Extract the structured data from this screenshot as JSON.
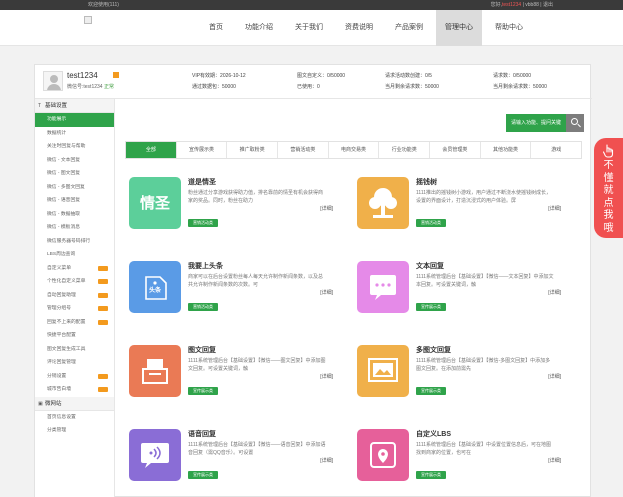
{
  "topbar": {
    "welcome": "欢迎使用(111)",
    "account_prefix": "您好,",
    "account_name": "test1234",
    "account_sep": "  |  vbb88  |  ",
    "logout": "退出"
  },
  "nav": {
    "items": [
      {
        "label": "首页"
      },
      {
        "label": "功能介绍"
      },
      {
        "label": "关于我们"
      },
      {
        "label": "资费说明"
      },
      {
        "label": "产品案例"
      },
      {
        "label": "管理中心"
      },
      {
        "label": "帮助中心"
      }
    ],
    "active": "管理中心"
  },
  "user": {
    "name": "test1234",
    "sub_prefix": "微信号:test1234 ",
    "sub_status": "正常",
    "stats": [
      {
        "text": "VIP有效期：2026-10-12"
      },
      {
        "text": "通过数据包：50000"
      },
      {
        "text": "图文自定义：0/50000"
      },
      {
        "text": "已使用：0"
      },
      {
        "text": "请求活动数创建：0/5"
      },
      {
        "text": "当月剩余请求数：50000"
      },
      {
        "text": "请求数：0/50000"
      },
      {
        "text": "当月剩余请求数：50000"
      }
    ]
  },
  "sidebar": {
    "section1": "基础设置",
    "items": [
      {
        "label": "功能展示",
        "active": true,
        "tag": false
      },
      {
        "label": "数据统计",
        "active": false,
        "tag": false
      },
      {
        "label": "关注时回复与帮助",
        "active": false,
        "tag": false
      },
      {
        "label": "微信 - 文本回复",
        "active": false,
        "tag": false
      },
      {
        "label": "微信 - 图文回复",
        "active": false,
        "tag": false
      },
      {
        "label": "微信 - 多图文回复",
        "active": false,
        "tag": false
      },
      {
        "label": "微信 - 语音回复",
        "active": false,
        "tag": false
      },
      {
        "label": "微信 - 数据抽取",
        "active": false,
        "tag": false
      },
      {
        "label": "微信 - 模板消息",
        "active": false,
        "tag": false
      },
      {
        "label": "微信服务器号码排行",
        "active": false,
        "tag": false
      },
      {
        "label": "LBS周边查询",
        "active": false,
        "tag": false
      },
      {
        "label": "自定义菜单",
        "active": false,
        "tag": true
      },
      {
        "label": "个性化自定义菜单",
        "active": false,
        "tag": true
      },
      {
        "label": "自动回复助理",
        "active": false,
        "tag": true
      },
      {
        "label": "管理分组号",
        "active": false,
        "tag": true
      },
      {
        "label": "回复不上来的配置",
        "active": false,
        "tag": true
      },
      {
        "label": "快捷平台配置",
        "active": false,
        "tag": false
      },
      {
        "label": "图文回复生成工具",
        "active": false,
        "tag": false
      },
      {
        "label": "评论回复管理",
        "active": false,
        "tag": false
      },
      {
        "label": "分销设置",
        "active": false,
        "tag": true
      },
      {
        "label": "城市告白墙",
        "active": false,
        "tag": true
      }
    ],
    "section2": "微网站",
    "items2": [
      {
        "label": "首页信息设置"
      },
      {
        "label": "分类管理"
      }
    ]
  },
  "toolbar": {
    "add_label": "请输入功能、提问关键",
    "search_icon": "search-icon"
  },
  "tabs": [
    {
      "label": "全部",
      "active": true
    },
    {
      "label": "宣传展示类",
      "active": false
    },
    {
      "label": "推广取粉类",
      "active": false
    },
    {
      "label": "营销活动类",
      "active": false
    },
    {
      "label": "电商交易类",
      "active": false
    },
    {
      "label": "行业功能类",
      "active": false
    },
    {
      "label": "会员管理类",
      "active": false
    },
    {
      "label": "其他功能类",
      "active": false
    },
    {
      "label": "游戏",
      "active": false
    }
  ],
  "cards": [
    {
      "title": "道是情圣",
      "desc": "粉丝通过分享游戏获得助力值，排名靠前的情圣有机会获得商家的奖品。同时，粉丝在助力",
      "more": "[详细]",
      "tag": "营销活动类",
      "color": "#5ccf9a",
      "icon": "lovers-icon",
      "glyph": "情圣"
    },
    {
      "title": "摇钱树",
      "desc": "1111推出的摇钱树小游戏，用户通过不断浇水使摇钱树成长，设置的界面设计，打造沉浸式的用户体验。屏",
      "more": "[详细]",
      "tag": "营销活动类",
      "color": "#f0b04a",
      "icon": "money-tree-icon",
      "glyph": ""
    },
    {
      "title": "我要上头条",
      "desc": "商家可以在后台设置粉丝每人每天允许制作新闻条数，以及总共允许制作新闻条数的次数。可",
      "more": "[详细]",
      "tag": "营销活动类",
      "color": "#5a9be6",
      "icon": "headline-icon",
      "glyph": "头条"
    },
    {
      "title": "文本回复",
      "desc": "1111系统管理后台【基础设置】【微信——文本回复】中添加文本回复。可设置关键词，触",
      "more": "[详细]",
      "tag": "宣传展示类",
      "color": "#e58ae8",
      "icon": "text-reply-icon",
      "glyph": ""
    },
    {
      "title": "图文回复",
      "desc": "1111系统管理后台【基础设置】【微信——图文回复】中添加图文回复。可设置关键词，触",
      "more": "[详细]",
      "tag": "宣传展示类",
      "color": "#ea7a55",
      "icon": "image-text-icon",
      "glyph": ""
    },
    {
      "title": "多图文回复",
      "desc": "1111系统管理后台【基础设置】【微信-多图文回复】中添加多图文回复。在添加前需先",
      "more": "[详细]",
      "tag": "宣传展示类",
      "color": "#f0b04a",
      "icon": "multi-image-icon",
      "glyph": ""
    },
    {
      "title": "语音回复",
      "desc": "1111系统管理后台【基础设置】【微信——语音回复】中添加语音回复（需QQ音乐）。可设置",
      "more": "[详细]",
      "tag": "宣传展示类",
      "color": "#8a6dd6",
      "icon": "voice-reply-icon",
      "glyph": ""
    },
    {
      "title": "自定义LBS",
      "desc": "1111系统管理后台【基础设置】中设置位置信息后，可在地图找到商家的位置，也可在",
      "more": "[详细]",
      "tag": "宣传展示类",
      "color": "#e6609a",
      "icon": "lbs-pin-icon",
      "glyph": ""
    }
  ],
  "float_widget": {
    "icon": "hand-icon",
    "text": "不懂就点我哦",
    "color": "#f05050"
  }
}
